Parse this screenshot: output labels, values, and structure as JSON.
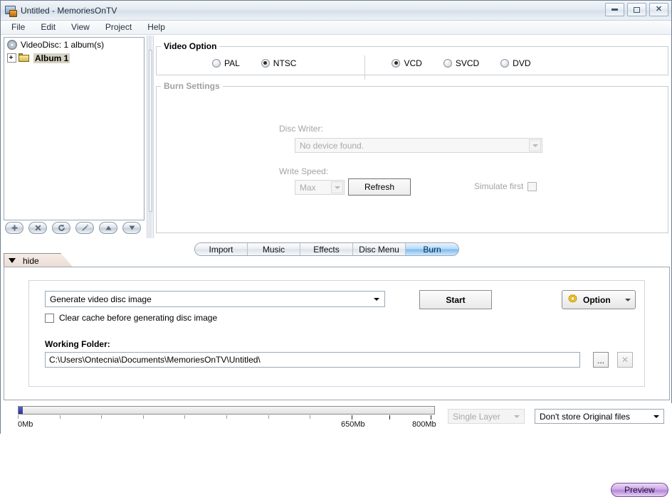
{
  "window": {
    "title": "Untitled - MemoriesOnTV",
    "icon": "app-monitor-icon",
    "controls": {
      "minimize": "–",
      "maximize": "▭",
      "close": "✕"
    }
  },
  "menubar": {
    "items": [
      {
        "label": "File"
      },
      {
        "label": "Edit"
      },
      {
        "label": "View"
      },
      {
        "label": "Project"
      },
      {
        "label": "Help"
      }
    ]
  },
  "tree": {
    "root": {
      "label": "VideoDisc: 1 album(s)",
      "icon": "disc-icon"
    },
    "children": [
      {
        "label": "Album 1",
        "icon": "folder-icon",
        "selected": true,
        "expandable": true
      }
    ],
    "toolbar": [
      {
        "name": "add-button",
        "glyph": "+"
      },
      {
        "name": "delete-button",
        "glyph": "×"
      },
      {
        "name": "refresh-button",
        "glyph": "↻"
      },
      {
        "name": "edit-button",
        "glyph": "✎"
      },
      {
        "name": "move-up-button",
        "glyph": "▲"
      },
      {
        "name": "move-down-button",
        "glyph": "▼"
      }
    ]
  },
  "video_option": {
    "legend": "Video Option",
    "standards": [
      {
        "label": "PAL",
        "checked": false
      },
      {
        "label": "NTSC",
        "checked": true
      }
    ],
    "formats": [
      {
        "label": "VCD",
        "checked": true
      },
      {
        "label": "SVCD",
        "checked": false
      },
      {
        "label": "DVD",
        "checked": false
      }
    ]
  },
  "burn_settings": {
    "legend": "Burn Settings",
    "disc_writer_label": "Disc Writer:",
    "disc_writer_value": "No device found.",
    "write_speed_label": "Write Speed:",
    "write_speed_value": "Max",
    "refresh_label": "Refresh",
    "simulate_first_label": "Simulate first",
    "simulate_first_checked": false
  },
  "tabs": {
    "items": [
      {
        "label": "Import",
        "active": false
      },
      {
        "label": "Music",
        "active": false
      },
      {
        "label": "Effects",
        "active": false
      },
      {
        "label": "Disc Menu",
        "active": false
      },
      {
        "label": "Burn",
        "active": true
      }
    ],
    "preview_label": "Preview"
  },
  "bottom_panel": {
    "hide_tab_label": "hide",
    "burn_action_value": "Generate video disc image",
    "clear_cache_label": "Clear cache before generating disc image",
    "clear_cache_checked": false,
    "start_label": "Start",
    "option_label": "Option",
    "option_icon": "gear-icon",
    "working_folder_label": "Working Folder:",
    "working_folder_value": "C:\\Users\\Ontecnia\\Documents\\MemoriesOnTV\\Untitled\\",
    "browse_label": "...",
    "clear_label": "✕"
  },
  "statusbar": {
    "capacity": {
      "fill_percent": 1,
      "labels": [
        {
          "text": "0Mb",
          "position_percent": 0
        },
        {
          "text": "650Mb",
          "position_percent": 80
        },
        {
          "text": "800Mb",
          "position_percent": 99
        }
      ]
    },
    "layer_value": "Single Layer",
    "store_value": "Don't store Original files"
  },
  "colors": {
    "accent_tab": "#7dbcf0",
    "preview": "#b487d8",
    "gear": "#f5c518",
    "capacity_fill": "#2b3392"
  }
}
